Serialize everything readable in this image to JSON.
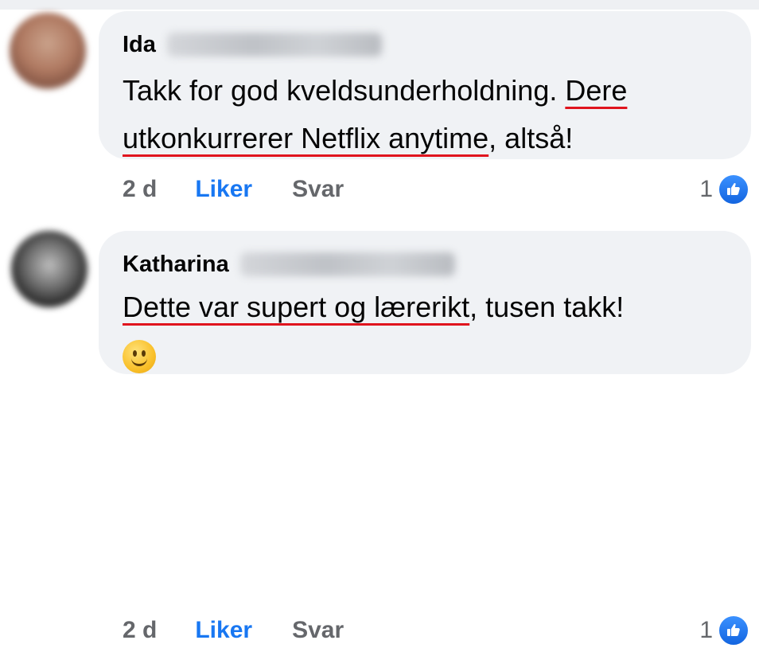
{
  "comments": [
    {
      "author": "Ida",
      "text_parts": [
        "Takk for god kveldsunderholdning. ",
        "Dere",
        "utkonkurrerer Netflix anytime",
        ", altså!"
      ],
      "time": "2 d",
      "like_label": "Liker",
      "reply_label": "Svar",
      "reaction_count": "1",
      "reaction_icon": "thumbs-up-icon"
    },
    {
      "author": "Katharina",
      "text_parts": [
        "Dette var supert og lærerikt",
        ", tusen takk!"
      ],
      "emoji_icon": "smiling-face-icon",
      "time": "2 d",
      "like_label": "Liker",
      "reply_label": "Svar",
      "reaction_count": "1",
      "reaction_icon": "thumbs-up-icon"
    }
  ],
  "colors": {
    "bubble": "#f0f2f5",
    "like_blue": "#1877f2",
    "meta_gray": "#65676b",
    "underline_red": "#e0141e"
  }
}
